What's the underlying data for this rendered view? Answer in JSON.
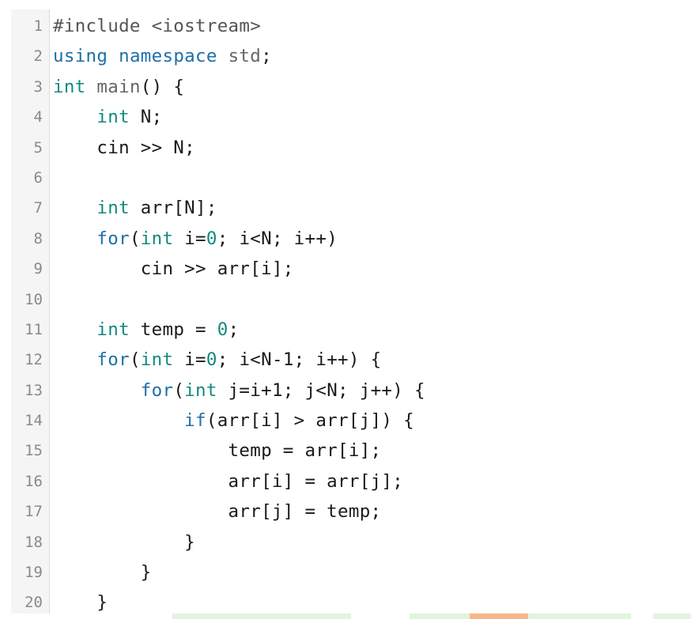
{
  "lines": [
    {
      "n": "1",
      "t": "#include <iostream>"
    },
    {
      "n": "2",
      "t": "using namespace std;"
    },
    {
      "n": "3",
      "t": "int main() {"
    },
    {
      "n": "4",
      "t": "    int N;"
    },
    {
      "n": "5",
      "t": "    cin >> N;"
    },
    {
      "n": "6",
      "t": ""
    },
    {
      "n": "7",
      "t": "    int arr[N];"
    },
    {
      "n": "8",
      "t": "    for(int i=0; i<N; i++)"
    },
    {
      "n": "9",
      "t": "        cin >> arr[i];"
    },
    {
      "n": "10",
      "t": ""
    },
    {
      "n": "11",
      "t": "    int temp = 0;"
    },
    {
      "n": "12",
      "t": "    for(int i=0; i<N-1; i++) {"
    },
    {
      "n": "13",
      "t": "        for(int j=i+1; j<N; j++) {"
    },
    {
      "n": "14",
      "t": "            if(arr[i] > arr[j]) {"
    },
    {
      "n": "15",
      "t": "                temp = arr[i];"
    },
    {
      "n": "16",
      "t": "                arr[i] = arr[j];"
    },
    {
      "n": "17",
      "t": "                arr[j] = temp;"
    },
    {
      "n": "18",
      "t": "            }"
    },
    {
      "n": "19",
      "t": "        }"
    },
    {
      "n": "20",
      "t": "    }"
    }
  ],
  "colors": {
    "keyword": "#1d6fa8",
    "type": "#118a7e",
    "preprocessor": "#555555",
    "gutter_bg": "#f5f5f5",
    "line_number": "#8a8a8a",
    "bottom_green": "#e2f3df",
    "bottom_orange": "#f7b78b"
  }
}
